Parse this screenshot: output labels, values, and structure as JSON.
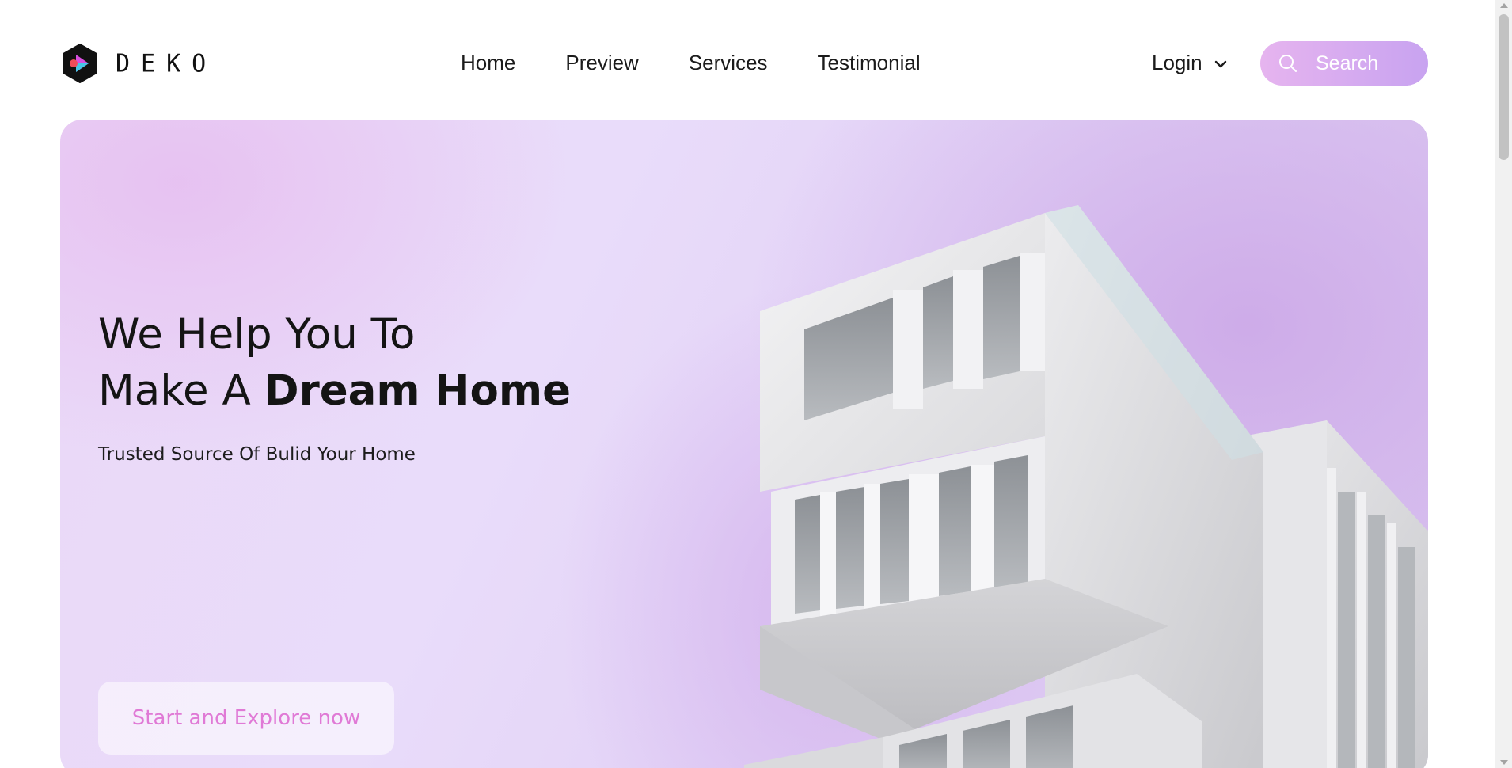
{
  "brand": {
    "name": "DEKO",
    "logo_icon": "deko-logo-icon"
  },
  "nav": {
    "links": [
      {
        "label": "Home"
      },
      {
        "label": "Preview"
      },
      {
        "label": "Services"
      },
      {
        "label": "Testimonial"
      }
    ],
    "login_label": "Login",
    "login_icon": "chevron-down-icon"
  },
  "search": {
    "placeholder": "Search",
    "icon": "search-icon"
  },
  "hero": {
    "title_line1": "We Help You To",
    "title_line2_prefix": "Make A ",
    "title_line2_bold": "Dream Home",
    "subtitle": "Trusted Source Of Bulid Your Home",
    "cta_label": "Start and Explore now",
    "image": "modern-white-building-image"
  },
  "colors": {
    "accent_pink": "#e07ad6",
    "search_gradient_start": "#e6b4ef",
    "search_gradient_end": "#c8a3f0",
    "hero_background": "#e9dcfa"
  }
}
